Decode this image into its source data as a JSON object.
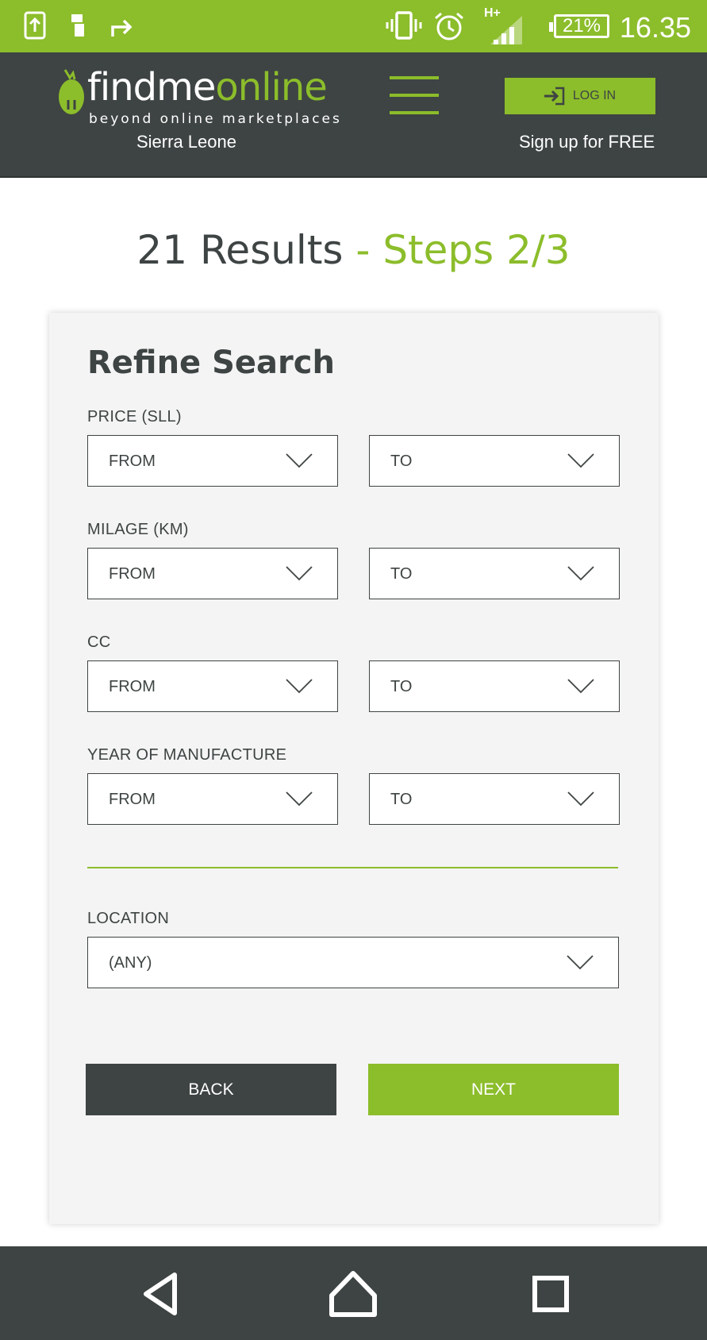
{
  "status_bar": {
    "network": "H+",
    "battery": "21%",
    "time": "16.35"
  },
  "header": {
    "logo_find": "findme",
    "logo_online": "online",
    "logo_tagline": "beyond online marketplaces",
    "country": "Sierra Leone",
    "login_label": "LOG IN",
    "signup_label": "Sign up for FREE"
  },
  "page": {
    "results": "21 Results",
    "steps": " - Steps 2/3"
  },
  "refine": {
    "title": "Refine Search",
    "price": {
      "label": "PRICE (SLL)",
      "from": "FROM",
      "to": "TO"
    },
    "milage": {
      "label": "MILAGE (KM)",
      "from": "FROM",
      "to": "TO"
    },
    "cc": {
      "label": "CC",
      "from": "FROM",
      "to": "TO"
    },
    "year": {
      "label": "YEAR OF MANUFACTURE",
      "from": "FROM",
      "to": "TO"
    },
    "location": {
      "label": "LOCATION",
      "value": "(ANY)"
    },
    "back_label": "BACK",
    "next_label": "NEXT"
  },
  "colors": {
    "accent": "#8cbd2b",
    "dark": "#3e4443",
    "card_bg": "#f4f4f4"
  },
  "icons": {
    "status": [
      "screenshot-icon",
      "usb-icon",
      "share-icon",
      "vibrate-icon",
      "alarm-icon",
      "signal-icon",
      "battery-icon"
    ],
    "nav": [
      "back-triangle-icon",
      "home-icon",
      "recents-icon"
    ]
  }
}
